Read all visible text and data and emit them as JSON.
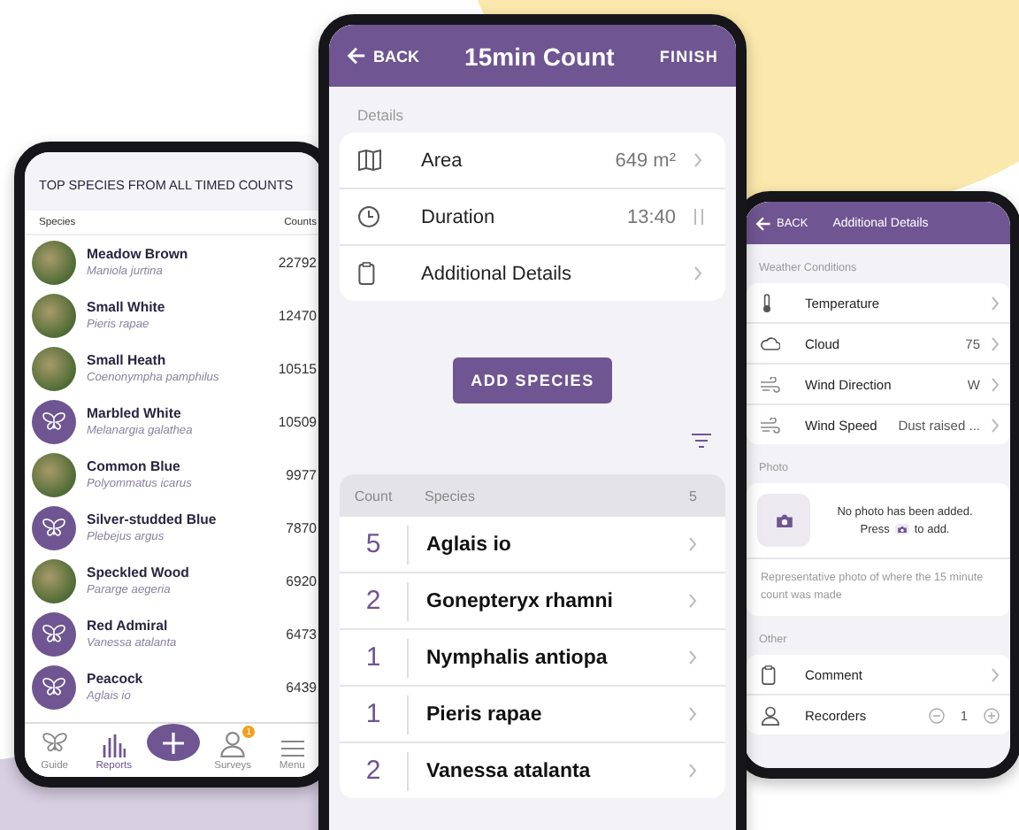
{
  "species_screen": {
    "title": "TOP SPECIES FROM ALL TIMED COUNTS",
    "columns": [
      "Species",
      "Counts"
    ],
    "rows": [
      {
        "name": "Meadow Brown",
        "latin": "Maniola jurtina",
        "count": "22792",
        "kind": "photo"
      },
      {
        "name": "Small White",
        "latin": "Pieris rapae",
        "count": "12470",
        "kind": "photo"
      },
      {
        "name": "Small Heath",
        "latin": "Coenonympha pamphilus",
        "count": "10515",
        "kind": "photo"
      },
      {
        "name": "Marbled White",
        "latin": "Melanargia galathea",
        "count": "10509",
        "kind": "icon"
      },
      {
        "name": "Common Blue",
        "latin": "Polyommatus icarus",
        "count": "9977",
        "kind": "photo"
      },
      {
        "name": "Silver-studded Blue",
        "latin": "Plebejus argus",
        "count": "7870",
        "kind": "icon"
      },
      {
        "name": "Speckled Wood",
        "latin": "Pararge aegeria",
        "count": "6920",
        "kind": "photo"
      },
      {
        "name": "Red Admiral",
        "latin": "Vanessa atalanta",
        "count": "6473",
        "kind": "icon"
      },
      {
        "name": "Peacock",
        "latin": "Aglais io",
        "count": "6439",
        "kind": "icon"
      }
    ],
    "tab_bar": [
      {
        "kind": "tab",
        "label": "Guide",
        "selected": false
      },
      {
        "kind": "tab",
        "label": "Reports",
        "selected": true
      },
      {
        "kind": "add",
        "selected": false
      },
      {
        "kind": "tab",
        "label": "Surveys",
        "badge": "1",
        "selected": false
      },
      {
        "kind": "tab",
        "label": "Menu",
        "selected": false
      }
    ]
  },
  "count_screen": {
    "header": {
      "back": "BACK",
      "title": "15min Count",
      "action": "FINISH"
    },
    "details_label": "Details",
    "details": [
      {
        "kind": "link",
        "label": "Area",
        "value": "649 m²"
      },
      {
        "kind": "timer",
        "label": "Duration",
        "value": "13:40"
      },
      {
        "kind": "link",
        "label": "Additional Details"
      }
    ],
    "add_button": "ADD SPECIES",
    "table": {
      "columns": [
        "Count",
        "Species",
        "5"
      ],
      "rows": [
        {
          "count": "5",
          "species": "Aglais io"
        },
        {
          "count": "2",
          "species": "Gonepteryx rhamni"
        },
        {
          "count": "1",
          "species": "Nymphalis antiopa"
        },
        {
          "count": "1",
          "species": "Pieris rapae"
        },
        {
          "count": "2",
          "species": "Vanessa atalanta"
        }
      ]
    }
  },
  "details_screen": {
    "header": {
      "back": "BACK",
      "title": "Additional Details"
    },
    "weather_label": "Weather Conditions",
    "weather": [
      {
        "kind": "link",
        "label": "Temperature"
      },
      {
        "kind": "link",
        "label": "Cloud",
        "value": "75"
      },
      {
        "kind": "link",
        "label": "Wind Direction",
        "value": "W"
      },
      {
        "kind": "link",
        "label": "Wind Speed",
        "value": "Dust raised ..."
      }
    ],
    "photo_label": "Photo",
    "photo": {
      "message": "No photo has been added.",
      "hint_before": "Press",
      "hint_after": "to add.",
      "caption": "Representative photo of where the 15 minute count was made"
    },
    "other_label": "Other",
    "other": [
      {
        "kind": "link",
        "label": "Comment"
      },
      {
        "kind": "stepper",
        "label": "Recorders",
        "value": "1"
      }
    ]
  }
}
